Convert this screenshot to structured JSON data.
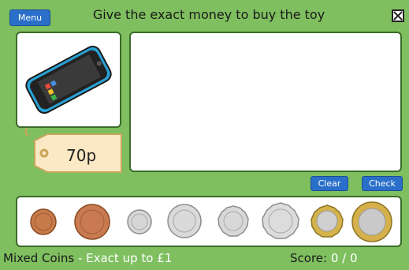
{
  "header": {
    "menu_label": "Menu",
    "title": "Give the exact money to buy the toy"
  },
  "toy": {
    "name_icon": "smartphone-icon",
    "price": "70p"
  },
  "actions": {
    "clear_label": "Clear",
    "check_label": "Check"
  },
  "coins": [
    {
      "icon": "coin-1p-icon"
    },
    {
      "icon": "coin-2p-icon"
    },
    {
      "icon": "coin-5p-icon"
    },
    {
      "icon": "coin-10p-icon"
    },
    {
      "icon": "coin-20p-icon"
    },
    {
      "icon": "coin-50p-icon"
    },
    {
      "icon": "coin-1-pound-icon"
    },
    {
      "icon": "coin-2-pound-icon"
    }
  ],
  "footer": {
    "mode": "Mixed Coins",
    "mode_detail": " - Exact up to £1",
    "score_label": "Score:",
    "score_value": " 0 / 0"
  },
  "colors": {
    "background": "#7fbf5f",
    "button": "#2a6fc9",
    "border": "#3b6b2a"
  }
}
